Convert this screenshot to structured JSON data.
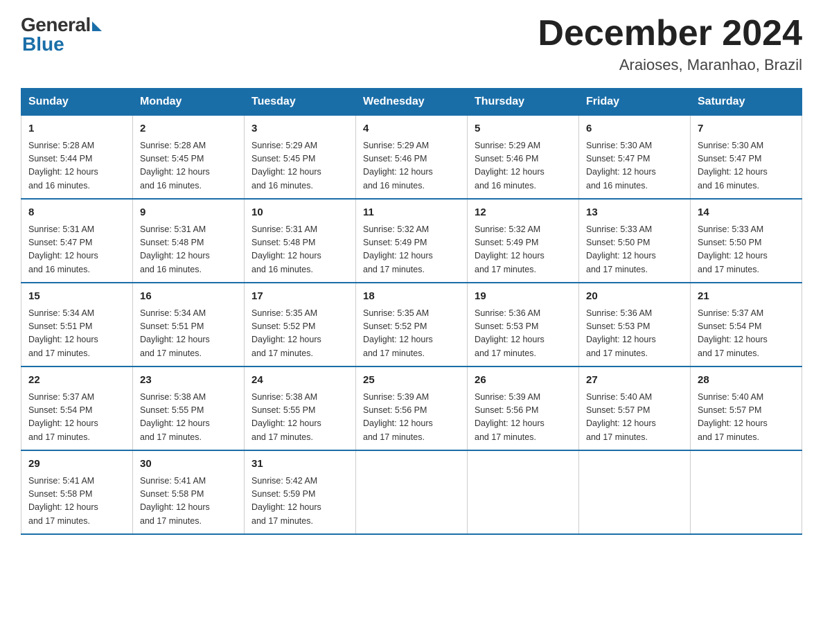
{
  "header": {
    "logo_general": "General",
    "logo_blue": "Blue",
    "month_title": "December 2024",
    "location": "Araioses, Maranhao, Brazil"
  },
  "weekdays": [
    "Sunday",
    "Monday",
    "Tuesday",
    "Wednesday",
    "Thursday",
    "Friday",
    "Saturday"
  ],
  "weeks": [
    [
      {
        "day": "1",
        "sunrise": "5:28 AM",
        "sunset": "5:44 PM",
        "daylight": "12 hours and 16 minutes."
      },
      {
        "day": "2",
        "sunrise": "5:28 AM",
        "sunset": "5:45 PM",
        "daylight": "12 hours and 16 minutes."
      },
      {
        "day": "3",
        "sunrise": "5:29 AM",
        "sunset": "5:45 PM",
        "daylight": "12 hours and 16 minutes."
      },
      {
        "day": "4",
        "sunrise": "5:29 AM",
        "sunset": "5:46 PM",
        "daylight": "12 hours and 16 minutes."
      },
      {
        "day": "5",
        "sunrise": "5:29 AM",
        "sunset": "5:46 PM",
        "daylight": "12 hours and 16 minutes."
      },
      {
        "day": "6",
        "sunrise": "5:30 AM",
        "sunset": "5:47 PM",
        "daylight": "12 hours and 16 minutes."
      },
      {
        "day": "7",
        "sunrise": "5:30 AM",
        "sunset": "5:47 PM",
        "daylight": "12 hours and 16 minutes."
      }
    ],
    [
      {
        "day": "8",
        "sunrise": "5:31 AM",
        "sunset": "5:47 PM",
        "daylight": "12 hours and 16 minutes."
      },
      {
        "day": "9",
        "sunrise": "5:31 AM",
        "sunset": "5:48 PM",
        "daylight": "12 hours and 16 minutes."
      },
      {
        "day": "10",
        "sunrise": "5:31 AM",
        "sunset": "5:48 PM",
        "daylight": "12 hours and 16 minutes."
      },
      {
        "day": "11",
        "sunrise": "5:32 AM",
        "sunset": "5:49 PM",
        "daylight": "12 hours and 17 minutes."
      },
      {
        "day": "12",
        "sunrise": "5:32 AM",
        "sunset": "5:49 PM",
        "daylight": "12 hours and 17 minutes."
      },
      {
        "day": "13",
        "sunrise": "5:33 AM",
        "sunset": "5:50 PM",
        "daylight": "12 hours and 17 minutes."
      },
      {
        "day": "14",
        "sunrise": "5:33 AM",
        "sunset": "5:50 PM",
        "daylight": "12 hours and 17 minutes."
      }
    ],
    [
      {
        "day": "15",
        "sunrise": "5:34 AM",
        "sunset": "5:51 PM",
        "daylight": "12 hours and 17 minutes."
      },
      {
        "day": "16",
        "sunrise": "5:34 AM",
        "sunset": "5:51 PM",
        "daylight": "12 hours and 17 minutes."
      },
      {
        "day": "17",
        "sunrise": "5:35 AM",
        "sunset": "5:52 PM",
        "daylight": "12 hours and 17 minutes."
      },
      {
        "day": "18",
        "sunrise": "5:35 AM",
        "sunset": "5:52 PM",
        "daylight": "12 hours and 17 minutes."
      },
      {
        "day": "19",
        "sunrise": "5:36 AM",
        "sunset": "5:53 PM",
        "daylight": "12 hours and 17 minutes."
      },
      {
        "day": "20",
        "sunrise": "5:36 AM",
        "sunset": "5:53 PM",
        "daylight": "12 hours and 17 minutes."
      },
      {
        "day": "21",
        "sunrise": "5:37 AM",
        "sunset": "5:54 PM",
        "daylight": "12 hours and 17 minutes."
      }
    ],
    [
      {
        "day": "22",
        "sunrise": "5:37 AM",
        "sunset": "5:54 PM",
        "daylight": "12 hours and 17 minutes."
      },
      {
        "day": "23",
        "sunrise": "5:38 AM",
        "sunset": "5:55 PM",
        "daylight": "12 hours and 17 minutes."
      },
      {
        "day": "24",
        "sunrise": "5:38 AM",
        "sunset": "5:55 PM",
        "daylight": "12 hours and 17 minutes."
      },
      {
        "day": "25",
        "sunrise": "5:39 AM",
        "sunset": "5:56 PM",
        "daylight": "12 hours and 17 minutes."
      },
      {
        "day": "26",
        "sunrise": "5:39 AM",
        "sunset": "5:56 PM",
        "daylight": "12 hours and 17 minutes."
      },
      {
        "day": "27",
        "sunrise": "5:40 AM",
        "sunset": "5:57 PM",
        "daylight": "12 hours and 17 minutes."
      },
      {
        "day": "28",
        "sunrise": "5:40 AM",
        "sunset": "5:57 PM",
        "daylight": "12 hours and 17 minutes."
      }
    ],
    [
      {
        "day": "29",
        "sunrise": "5:41 AM",
        "sunset": "5:58 PM",
        "daylight": "12 hours and 17 minutes."
      },
      {
        "day": "30",
        "sunrise": "5:41 AM",
        "sunset": "5:58 PM",
        "daylight": "12 hours and 17 minutes."
      },
      {
        "day": "31",
        "sunrise": "5:42 AM",
        "sunset": "5:59 PM",
        "daylight": "12 hours and 17 minutes."
      },
      null,
      null,
      null,
      null
    ]
  ],
  "labels": {
    "sunrise_prefix": "Sunrise: ",
    "sunset_prefix": "Sunset: ",
    "daylight_prefix": "Daylight: "
  }
}
